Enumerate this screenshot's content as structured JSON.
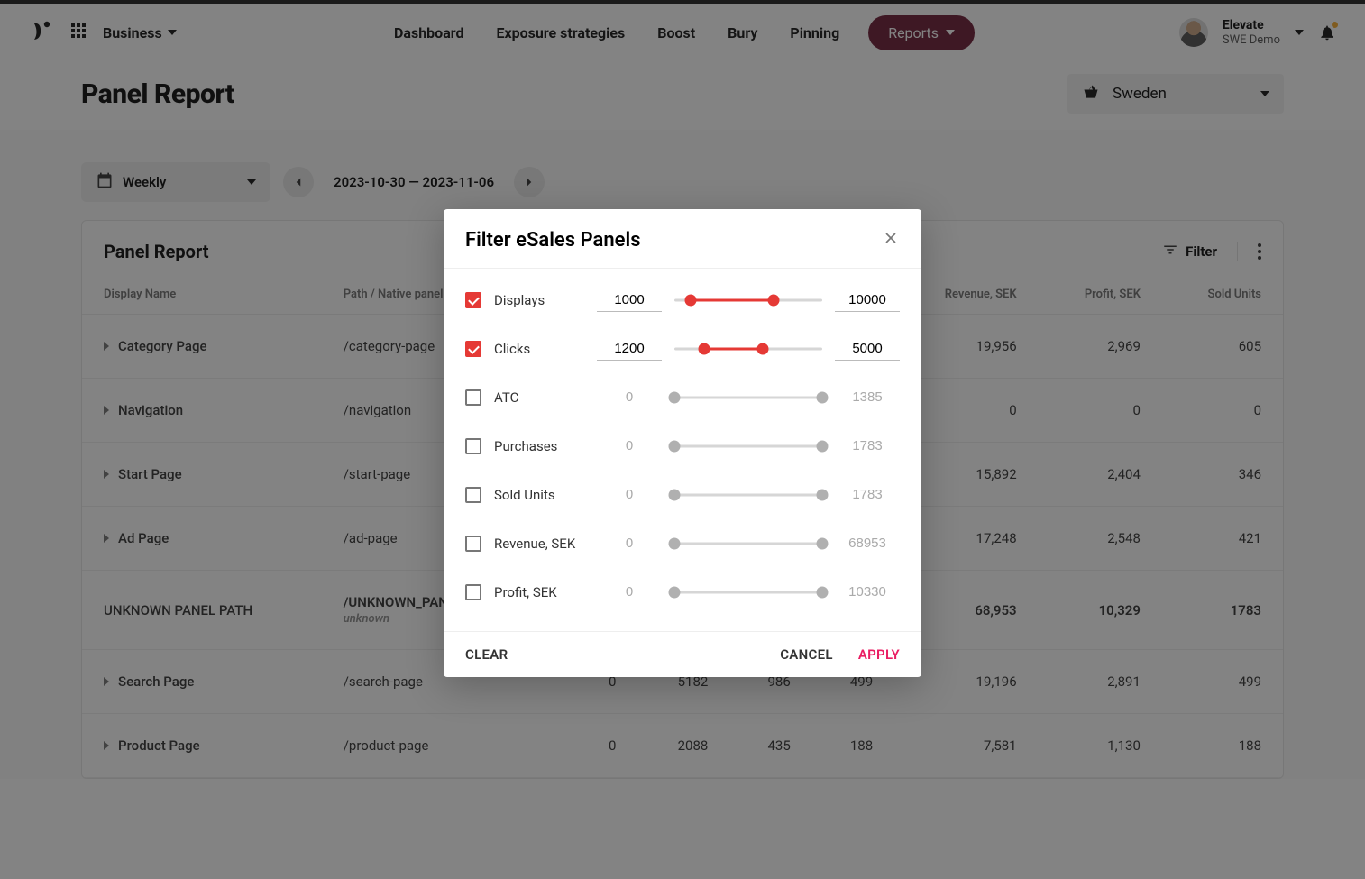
{
  "header": {
    "site_name": "Business",
    "nav": [
      "Dashboard",
      "Exposure strategies",
      "Boost",
      "Bury",
      "Pinning"
    ],
    "reports_label": "Reports",
    "user_line1": "Elevate",
    "user_line2": "SWE Demo"
  },
  "page_title": "Panel Report",
  "market": "Sweden",
  "controls": {
    "period_label": "Weekly",
    "range_label": "2023-10-30 — 2023-11-06"
  },
  "card": {
    "title": "Panel Report",
    "filter_label": "Filter",
    "columns": [
      "Display Name",
      "Path / Native panel",
      "",
      "",
      "",
      "",
      "Revenue, SEK",
      "Profit, SEK",
      "Sold Units"
    ],
    "rows": [
      {
        "name": "Category Page",
        "path": "/category-page",
        "c3": "",
        "c4": "",
        "c5": "",
        "c6": "",
        "rev": "19,956",
        "profit": "2,969",
        "units": "605",
        "expand": true
      },
      {
        "name": "Navigation",
        "path": "/navigation",
        "c3": "",
        "c4": "",
        "c5": "",
        "c6": "",
        "rev": "0",
        "profit": "0",
        "units": "0",
        "expand": true
      },
      {
        "name": "Start Page",
        "path": "/start-page",
        "c3": "",
        "c4": "",
        "c5": "",
        "c6": "",
        "rev": "15,892",
        "profit": "2,404",
        "units": "346",
        "expand": true
      },
      {
        "name": "Ad Page",
        "path": "/ad-page",
        "c3": "",
        "c4": "",
        "c5": "",
        "c6": "",
        "rev": "17,248",
        "profit": "2,548",
        "units": "421",
        "expand": true
      },
      {
        "name": "UNKNOWN PANEL PATH",
        "path": "/UNKNOWN_PANEL_PATH",
        "path2": "unknown",
        "c3": "",
        "c4": "",
        "c5": "",
        "c6": "",
        "rev": "68,953",
        "profit": "10,329",
        "units": "1783",
        "expand": false,
        "bold": true
      },
      {
        "name": "Search Page",
        "path": "/search-page",
        "c3": "0",
        "c4": "5182",
        "c5": "986",
        "c6": "499",
        "rev": "19,196",
        "profit": "2,891",
        "units": "499",
        "expand": true
      },
      {
        "name": "Product Page",
        "path": "/product-page",
        "c3": "0",
        "c4": "2088",
        "c5": "435",
        "c6": "188",
        "rev": "7,581",
        "profit": "1,130",
        "units": "188",
        "expand": true
      }
    ]
  },
  "dialog": {
    "title": "Filter eSales Panels",
    "clear": "CLEAR",
    "cancel": "CANCEL",
    "apply": "APPLY",
    "filters": [
      {
        "label": "Displays",
        "checked": true,
        "min": "1000",
        "max": "10000",
        "lo": 11,
        "hi": 67
      },
      {
        "label": "Clicks",
        "checked": true,
        "min": "1200",
        "max": "5000",
        "lo": 20,
        "hi": 60
      },
      {
        "label": "ATC",
        "checked": false,
        "min": "0",
        "max": "1385",
        "lo": 0,
        "hi": 100
      },
      {
        "label": "Purchases",
        "checked": false,
        "min": "0",
        "max": "1783",
        "lo": 0,
        "hi": 100
      },
      {
        "label": "Sold Units",
        "checked": false,
        "min": "0",
        "max": "1783",
        "lo": 0,
        "hi": 100
      },
      {
        "label": "Revenue, SEK",
        "checked": false,
        "min": "0",
        "max": "68953",
        "lo": 0,
        "hi": 100
      },
      {
        "label": "Profit, SEK",
        "checked": false,
        "min": "0",
        "max": "10330",
        "lo": 0,
        "hi": 100
      }
    ]
  }
}
